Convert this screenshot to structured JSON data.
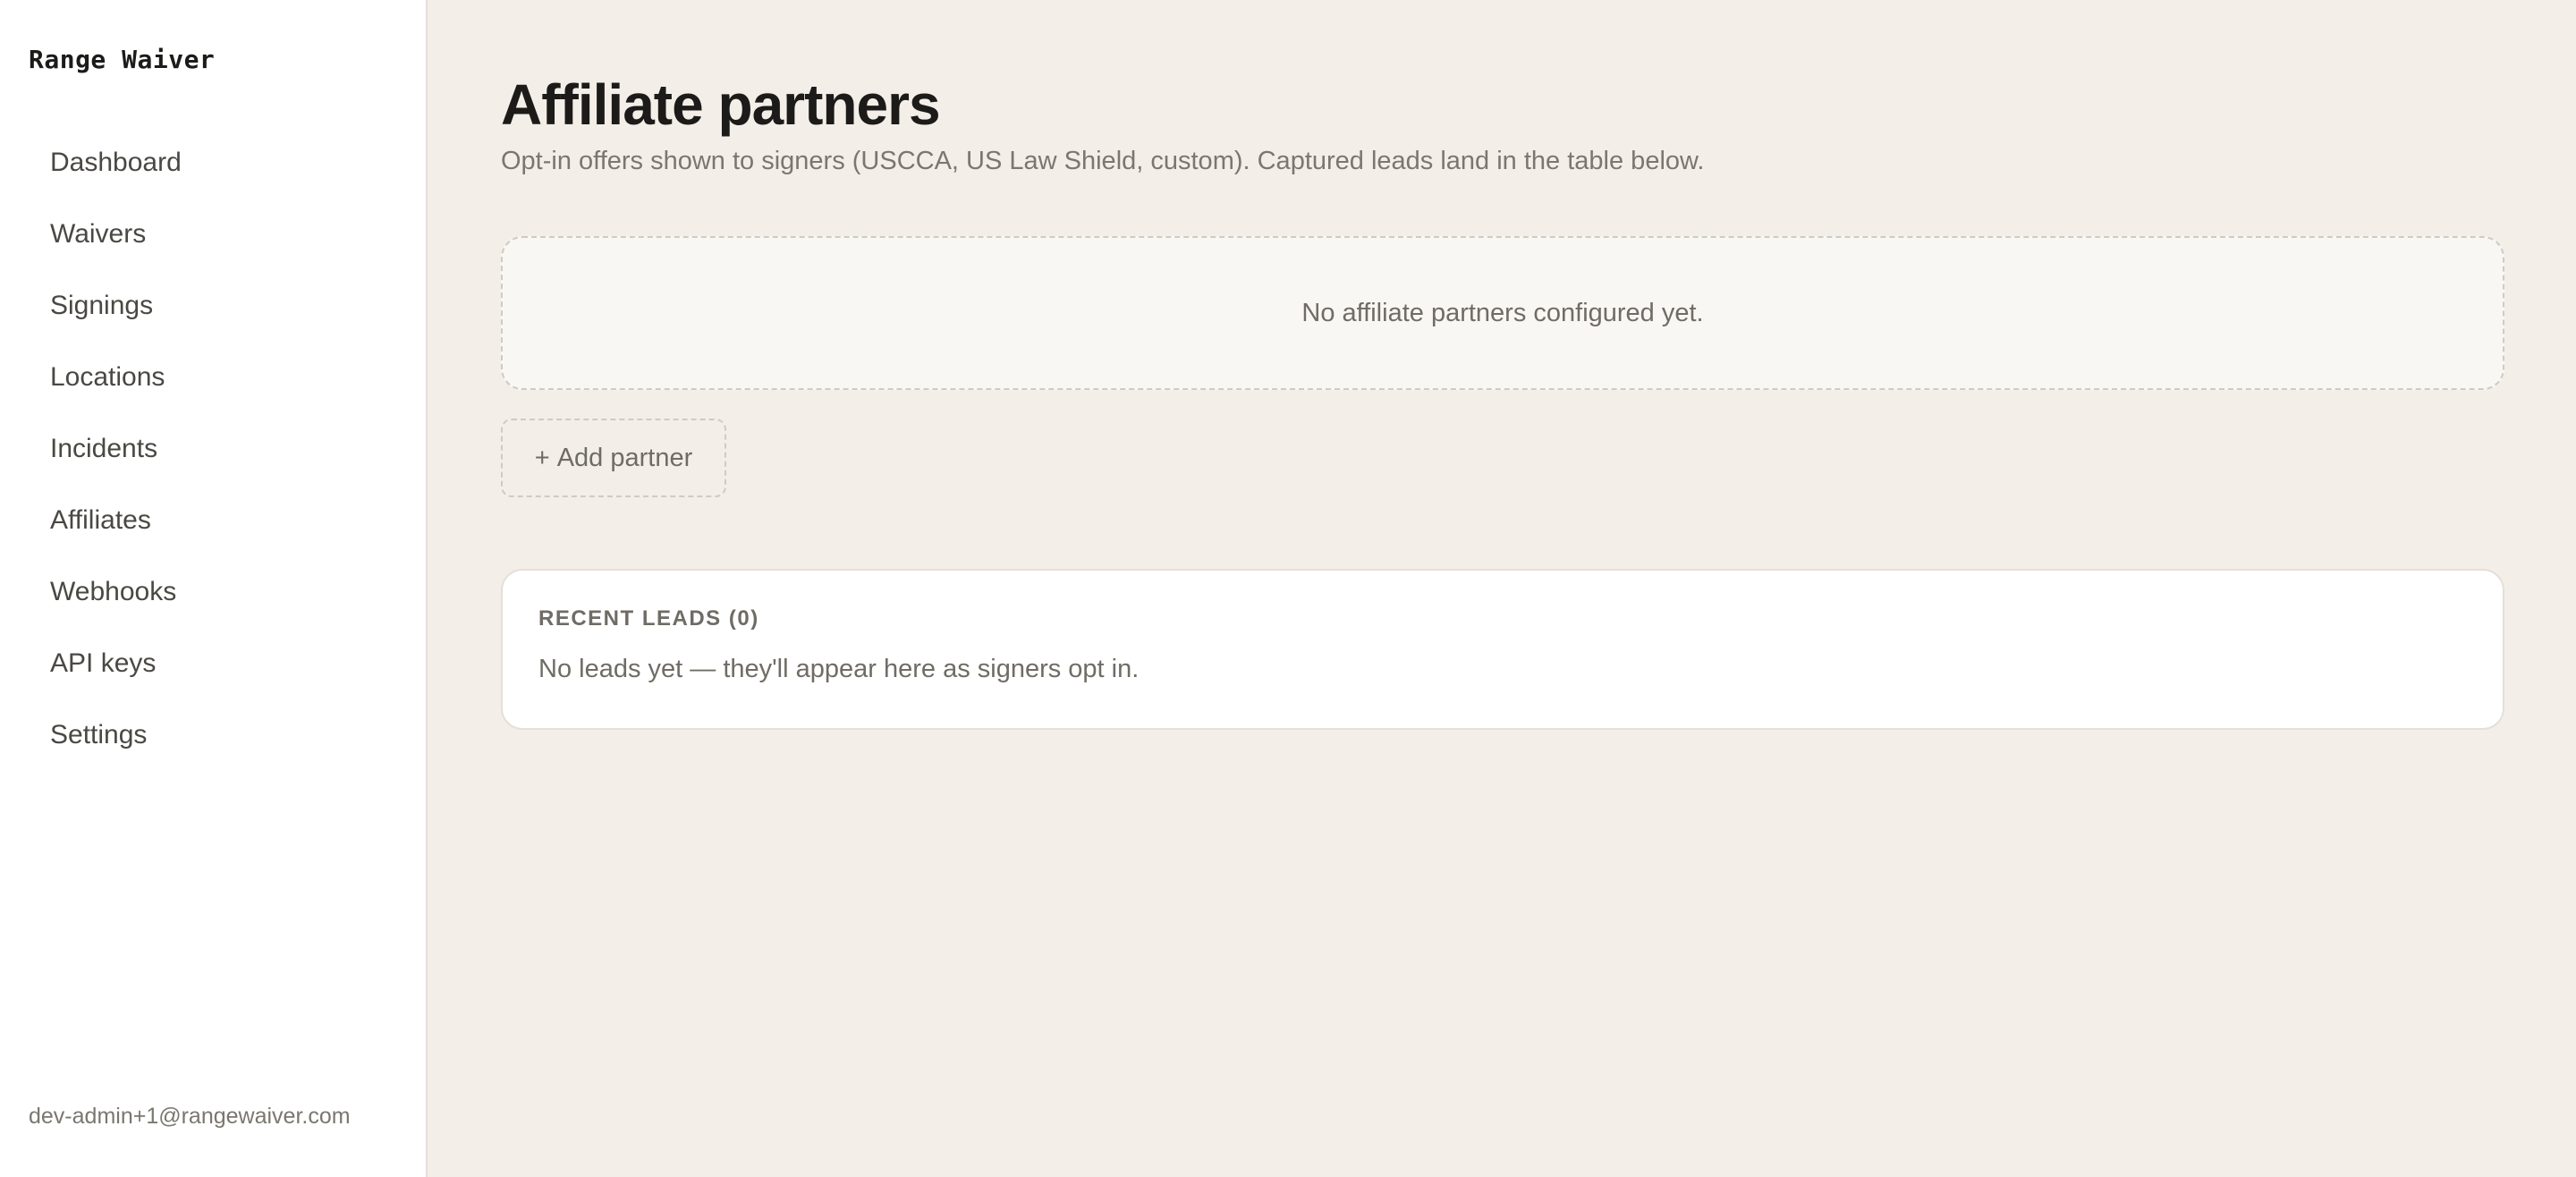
{
  "sidebar": {
    "brand": "Range Waiver",
    "items": [
      {
        "label": "Dashboard"
      },
      {
        "label": "Waivers"
      },
      {
        "label": "Signings"
      },
      {
        "label": "Locations"
      },
      {
        "label": "Incidents"
      },
      {
        "label": "Affiliates"
      },
      {
        "label": "Webhooks"
      },
      {
        "label": "API keys"
      },
      {
        "label": "Settings"
      }
    ],
    "user_email": "dev-admin+1@rangewaiver.com"
  },
  "main": {
    "title": "Affiliate partners",
    "subtitle": "Opt-in offers shown to signers (USCCA, US Law Shield, custom). Captured leads land in the table below.",
    "partners_empty": "No affiliate partners configured yet.",
    "add_partner": {
      "icon": "+",
      "label": "Add partner"
    },
    "leads": {
      "heading": "RECENT LEADS (0)",
      "empty": "No leads yet — they'll appear here as signers opt in."
    }
  },
  "colors": {
    "background": "#f3efe8",
    "sidebar_bg": "#ffffff",
    "text_primary": "#1c1b19",
    "text_muted": "#7a776f",
    "border": "#cfcbc2"
  }
}
